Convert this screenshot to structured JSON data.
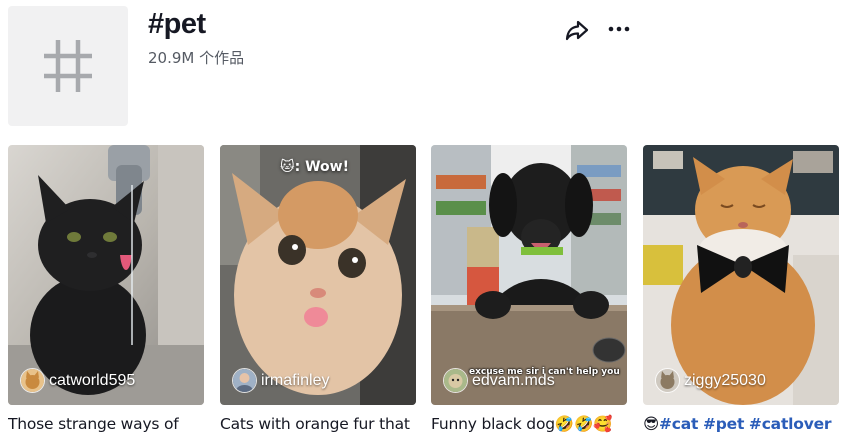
{
  "header": {
    "title": "#pet",
    "count": "20.9M 个作品",
    "share_icon": "share-icon",
    "more_icon": "more-icon"
  },
  "videos": [
    {
      "username": "catworld595",
      "caption": "Those strange ways of",
      "avatar_icon": "cat-avatar"
    },
    {
      "username": "irmafinley",
      "caption": "Cats with orange fur that",
      "overlay": "🐱: Wow!",
      "avatar_icon": "person-avatar"
    },
    {
      "username": "edvam.mds",
      "caption": "Funny black dog",
      "caption_emojis": "🤣🤣🥰",
      "overlay": "excuse me sir i can't help you",
      "avatar_icon": "dog-avatar"
    },
    {
      "username": "ziggy25030",
      "caption_emoji": "😎",
      "caption_tags": [
        "#cat",
        "#pet",
        "#catlover"
      ],
      "avatar_icon": "cat-avatar"
    }
  ]
}
